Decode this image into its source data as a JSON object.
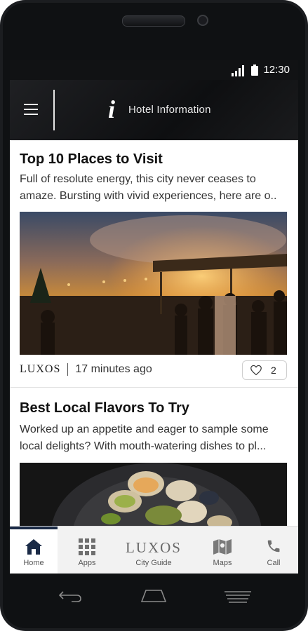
{
  "status": {
    "time": "12:30"
  },
  "appbar": {
    "title": "Hotel Information",
    "info_glyph": "i"
  },
  "articles": [
    {
      "title": "Top 10 Places to Visit",
      "excerpt_line1": "Full of resolute energy, this city never ceases to",
      "excerpt_line2": "amaze. Bursting with vivid experiences, here are o..",
      "image_name": "night-market-photo",
      "source": "LUXOS",
      "time": "17 minutes ago",
      "likes": "2"
    },
    {
      "title": "Best Local Flavors To Try",
      "excerpt_line1": "Worked up an appetite and eager to sample some",
      "excerpt_line2": "local delights? With mouth-watering dishes to pl...",
      "image_name": "seafood-dish-photo"
    }
  ],
  "bottom_nav": {
    "home": "Home",
    "apps": "Apps",
    "logo": "LUXOS",
    "city_guide": "City Guide",
    "maps": "Maps",
    "call": "Call"
  },
  "colors": {
    "appbar_bg": "#111214",
    "nav_bg": "#f2f2f2",
    "active_accent": "#1a2a46",
    "text_primary": "#111111"
  },
  "icons": [
    "menu-icon",
    "info-icon",
    "heart-icon",
    "home-icon",
    "apps-grid-icon",
    "maps-icon",
    "phone-icon",
    "back-icon",
    "home-hw-icon",
    "recents-icon"
  ]
}
